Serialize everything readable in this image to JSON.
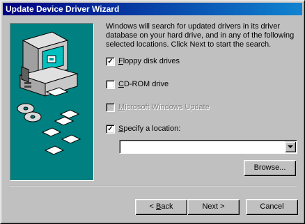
{
  "window": {
    "title": "Update Device Driver Wizard"
  },
  "description": "Windows will search for updated drivers in its driver database on your hard drive, and in any of the following selected locations. Click Next to start the search.",
  "options": [
    {
      "mnemonic": "F",
      "label_rest": "loppy disk drives",
      "checked": true,
      "enabled": true
    },
    {
      "mnemonic": "C",
      "label_rest": "D-ROM drive",
      "checked": false,
      "enabled": true
    },
    {
      "mnemonic": "M",
      "label_rest": "icrosoft Windows Update",
      "checked": false,
      "enabled": false
    },
    {
      "mnemonic": "S",
      "label_rest": "pecify a location:",
      "checked": true,
      "enabled": true
    }
  ],
  "location": {
    "value": ""
  },
  "buttons": {
    "browse": "Browse...",
    "back_prefix": "< ",
    "back_mnemonic": "B",
    "back_rest": "ack",
    "next": "Next >",
    "cancel": "Cancel"
  },
  "icons": [
    "computer-illustration",
    "cd-disc-icon",
    "floppy-disk-icon"
  ],
  "colors": {
    "title_start": "#000080",
    "title_end": "#1084d0",
    "art_bg": "#008080",
    "face": "#c0c0c0"
  }
}
